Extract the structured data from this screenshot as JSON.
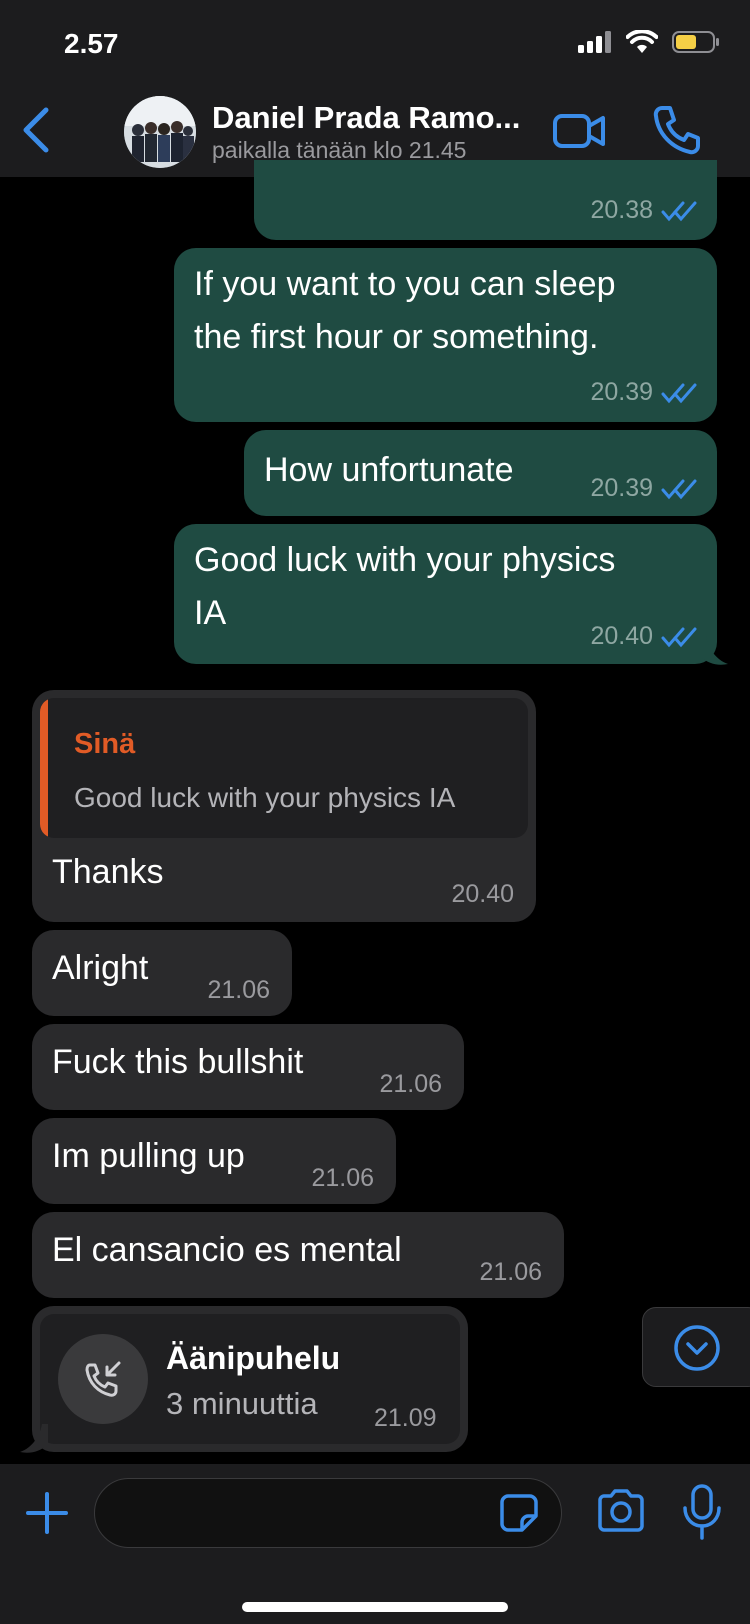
{
  "status_bar": {
    "time": "2.57"
  },
  "header": {
    "back_icon": "chevron-left-icon",
    "contact_name": "Daniel Prada Ramo...",
    "contact_status": "paikalla tänään klo 21.45",
    "video_icon": "video-camera-icon",
    "call_icon": "phone-icon"
  },
  "messages": [
    {
      "direction": "out",
      "text": "",
      "time": "20.38",
      "read": true
    },
    {
      "direction": "out",
      "lines": [
        "If you want to you can sleep",
        "the first hour or something."
      ],
      "time": "20.39",
      "read": true
    },
    {
      "direction": "out",
      "text": "How unfortunate",
      "time": "20.39",
      "read": true
    },
    {
      "direction": "out",
      "lines": [
        "Good luck with your physics",
        "IA"
      ],
      "time": "20.40",
      "read": true
    },
    {
      "direction": "in",
      "quote": {
        "author": "Sinä",
        "text": "Good luck with your physics IA"
      },
      "text": "Thanks",
      "time": "20.40"
    },
    {
      "direction": "in",
      "text": "Alright",
      "time": "21.06"
    },
    {
      "direction": "in",
      "text": "Fuck this bullshit",
      "time": "21.06"
    },
    {
      "direction": "in",
      "text": "Im pulling up",
      "time": "21.06"
    },
    {
      "direction": "in",
      "text": "El cansancio es mental",
      "time": "21.06"
    },
    {
      "direction": "in",
      "call": {
        "title": "Äänipuhelu",
        "duration": "3 minuuttia",
        "icon": "incoming-call-icon"
      },
      "time": "21.09"
    }
  ],
  "colors": {
    "outgoing_bubble": "#1f4b42",
    "incoming_bubble": "#2a2a2c",
    "accent_blue": "#3b8ce8",
    "quote_orange": "#e15b26"
  },
  "input_bar": {
    "placeholder": "",
    "plus_icon": "plus-icon",
    "sticker_icon": "sticker-icon",
    "camera_icon": "camera-icon",
    "mic_icon": "microphone-icon"
  },
  "scroll_down_icon": "chevron-down-circle-icon"
}
